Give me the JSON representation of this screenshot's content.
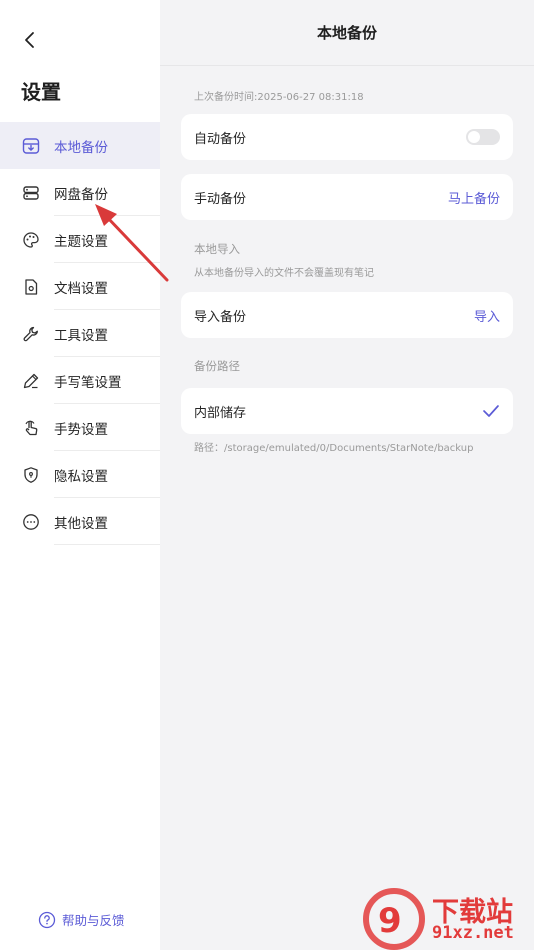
{
  "sidebar": {
    "title": "设置",
    "items": [
      {
        "label": "本地备份",
        "icon": "local-backup-icon",
        "active": true
      },
      {
        "label": "网盘备份",
        "icon": "cloud-drive-icon",
        "active": false
      },
      {
        "label": "主题设置",
        "icon": "palette-icon",
        "active": false
      },
      {
        "label": "文档设置",
        "icon": "document-gear-icon",
        "active": false
      },
      {
        "label": "工具设置",
        "icon": "wrench-icon",
        "active": false
      },
      {
        "label": "手写笔设置",
        "icon": "pen-icon",
        "active": false
      },
      {
        "label": "手势设置",
        "icon": "hand-gesture-icon",
        "active": false
      },
      {
        "label": "隐私设置",
        "icon": "shield-icon",
        "active": false
      },
      {
        "label": "其他设置",
        "icon": "more-icon",
        "active": false
      }
    ],
    "help_label": "帮助与反馈"
  },
  "main": {
    "title": "本地备份",
    "last_backup": "上次备份时间:2025-06-27 08:31:18",
    "auto_backup": {
      "label": "自动备份",
      "enabled": false
    },
    "manual_backup": {
      "label": "手动备份",
      "action": "马上备份"
    },
    "import_section": {
      "label": "本地导入",
      "desc": "从本地备份导入的文件不会覆盖现有笔记"
    },
    "import_backup": {
      "label": "导入备份",
      "action": "导入"
    },
    "path_section": {
      "label": "备份路径"
    },
    "internal_storage": {
      "label": "内部储存",
      "selected": true
    },
    "path_text": "路径：/storage/emulated/0/Documents/StarNote/backup"
  },
  "watermark": {
    "cn": "下载站",
    "en": "91xz.net"
  },
  "colors": {
    "accent": "#5b5bd6",
    "annotation": "#d93a3a",
    "background": "#f3f3f5"
  }
}
